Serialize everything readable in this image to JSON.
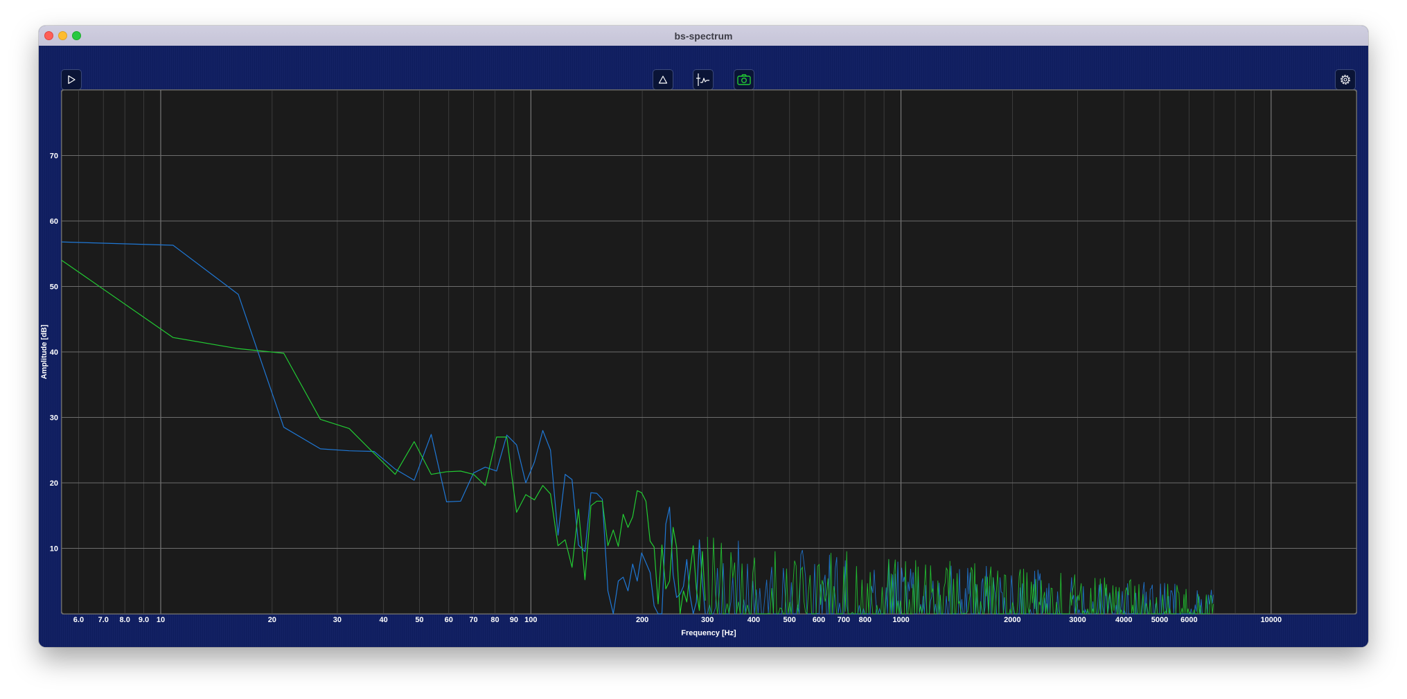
{
  "window": {
    "title": "bs-spectrum"
  },
  "toolbar": {
    "play": {
      "icon": "play-icon"
    },
    "delta": {
      "icon": "delta-icon"
    },
    "trace": {
      "icon": "trace-marker-icon"
    },
    "snapshot": {
      "icon": "camera-icon"
    },
    "settings": {
      "icon": "gear-icon"
    }
  },
  "colors": {
    "background": "#0e1d60",
    "plot_background": "#1b1b1b",
    "series_blue": "#1f78d6",
    "series_green": "#22cc33"
  },
  "chart_data": {
    "type": "line",
    "xlabel": "Frequency [Hz]",
    "ylabel": "Amplitude [dB]",
    "xscale": "log",
    "xlim": [
      5.4,
      17000
    ],
    "ylim": [
      0,
      80
    ],
    "grid": true,
    "x_tick_labels": [
      "6.0",
      "7.0",
      "8.0",
      "9.0",
      "10",
      "20",
      "30",
      "40",
      "50",
      "60",
      "70",
      "80",
      "90",
      "100",
      "200",
      "300",
      "400",
      "500",
      "600",
      "700",
      "800",
      "1000",
      "2000",
      "3000",
      "4000",
      "5000",
      "6000",
      "10000"
    ],
    "x_tick_values": [
      6,
      7,
      8,
      9,
      10,
      20,
      30,
      40,
      50,
      60,
      70,
      80,
      90,
      100,
      200,
      300,
      400,
      500,
      600,
      700,
      800,
      1000,
      2000,
      3000,
      4000,
      5000,
      6000,
      10000
    ],
    "y_tick_labels": [
      "10",
      "20",
      "30",
      "40",
      "50",
      "60",
      "70"
    ],
    "y_tick_values": [
      10,
      20,
      30,
      40,
      50,
      60,
      70
    ],
    "series": [
      {
        "color": "#1f78d6",
        "points": [
          [
            5.4,
            56.8
          ],
          [
            10.8,
            56.3
          ],
          [
            16.2,
            48.8
          ],
          [
            21.5,
            28.5
          ],
          [
            27,
            25.2
          ],
          [
            32.3,
            24.9
          ],
          [
            37.7,
            24.8
          ],
          [
            43,
            22.1
          ],
          [
            48.4,
            20.4
          ],
          [
            53.8,
            27.4
          ],
          [
            59.2,
            17.1
          ],
          [
            64.6,
            17.2
          ],
          [
            70,
            21.5
          ],
          [
            75.3,
            22.4
          ],
          [
            80.8,
            21.8
          ],
          [
            86.1,
            27.3
          ],
          [
            91.5,
            25.8
          ],
          [
            96.9,
            20
          ],
          [
            102.3,
            23.2
          ],
          [
            107.7,
            28
          ],
          [
            113,
            25
          ],
          [
            118.4,
            12
          ],
          [
            123.8,
            21.3
          ],
          [
            129.2,
            20.5
          ],
          [
            134.5,
            10.5
          ],
          [
            140,
            9.5
          ],
          [
            145.3,
            18.5
          ],
          [
            150.7,
            18.4
          ],
          [
            156,
            17.5
          ],
          [
            161.5,
            3.5
          ],
          [
            167,
            0
          ],
          [
            172.3,
            5
          ],
          [
            177.6,
            5.6
          ],
          [
            183,
            3.5
          ],
          [
            188.4,
            7.6
          ],
          [
            193.8,
            5
          ],
          [
            199.2,
            9.3
          ],
          [
            204.6,
            7.8
          ],
          [
            210,
            6.3
          ],
          [
            215.3,
            1.2
          ],
          [
            220.7,
            0
          ],
          [
            226,
            0
          ],
          [
            231.5,
            13.7
          ],
          [
            237,
            16.3
          ],
          [
            242.3,
            6
          ],
          [
            247.6,
            2.5
          ],
          [
            253,
            3
          ],
          [
            258.4,
            4.2
          ],
          [
            263.8,
            8.3
          ],
          [
            269.2,
            2.8
          ],
          [
            274.6,
            0
          ],
          [
            280,
            1.8
          ],
          [
            285.3,
            11.3
          ],
          [
            290.7,
            4.8
          ],
          [
            296,
            0
          ]
        ]
      },
      {
        "color": "#22cc33",
        "points": [
          [
            5.4,
            54
          ],
          [
            10.8,
            42.2
          ],
          [
            16.2,
            40.5
          ],
          [
            21.5,
            39.8
          ],
          [
            27,
            29.7
          ],
          [
            32.3,
            28.3
          ],
          [
            37.7,
            24.5
          ],
          [
            43,
            21.3
          ],
          [
            48.4,
            26.3
          ],
          [
            53.8,
            21.3
          ],
          [
            59.2,
            21.7
          ],
          [
            64.6,
            21.8
          ],
          [
            70,
            21.3
          ],
          [
            75.3,
            19.6
          ],
          [
            80.8,
            27
          ],
          [
            86.1,
            27
          ],
          [
            91.5,
            15.5
          ],
          [
            96.9,
            18.2
          ],
          [
            102.3,
            17.4
          ],
          [
            107.7,
            19.6
          ],
          [
            113,
            18.3
          ],
          [
            118.4,
            10.4
          ],
          [
            123.8,
            11.3
          ],
          [
            129.2,
            7.1
          ],
          [
            134.5,
            16
          ],
          [
            140,
            5.2
          ],
          [
            145.3,
            16.5
          ],
          [
            150.7,
            17.2
          ],
          [
            156,
            17.2
          ],
          [
            161.5,
            10.4
          ],
          [
            167,
            12.8
          ],
          [
            172.3,
            10.3
          ],
          [
            177.6,
            15.2
          ],
          [
            183,
            13.2
          ],
          [
            188.4,
            14.8
          ],
          [
            193.8,
            18.8
          ],
          [
            199.2,
            18.5
          ],
          [
            204.6,
            17.2
          ],
          [
            210,
            11.1
          ],
          [
            215.3,
            10.2
          ],
          [
            220.7,
            1.5
          ],
          [
            226,
            10.5
          ],
          [
            231.5,
            3.8
          ],
          [
            237,
            5
          ],
          [
            242.3,
            13.2
          ],
          [
            247.6,
            10.2
          ],
          [
            253,
            0
          ],
          [
            258.4,
            3.5
          ],
          [
            263.8,
            1.8
          ],
          [
            269.2,
            6.5
          ],
          [
            274.6,
            10.4
          ],
          [
            280,
            3.8
          ],
          [
            285.3,
            0.5
          ],
          [
            290.7,
            9.5
          ],
          [
            296,
            2
          ]
        ]
      }
    ]
  }
}
